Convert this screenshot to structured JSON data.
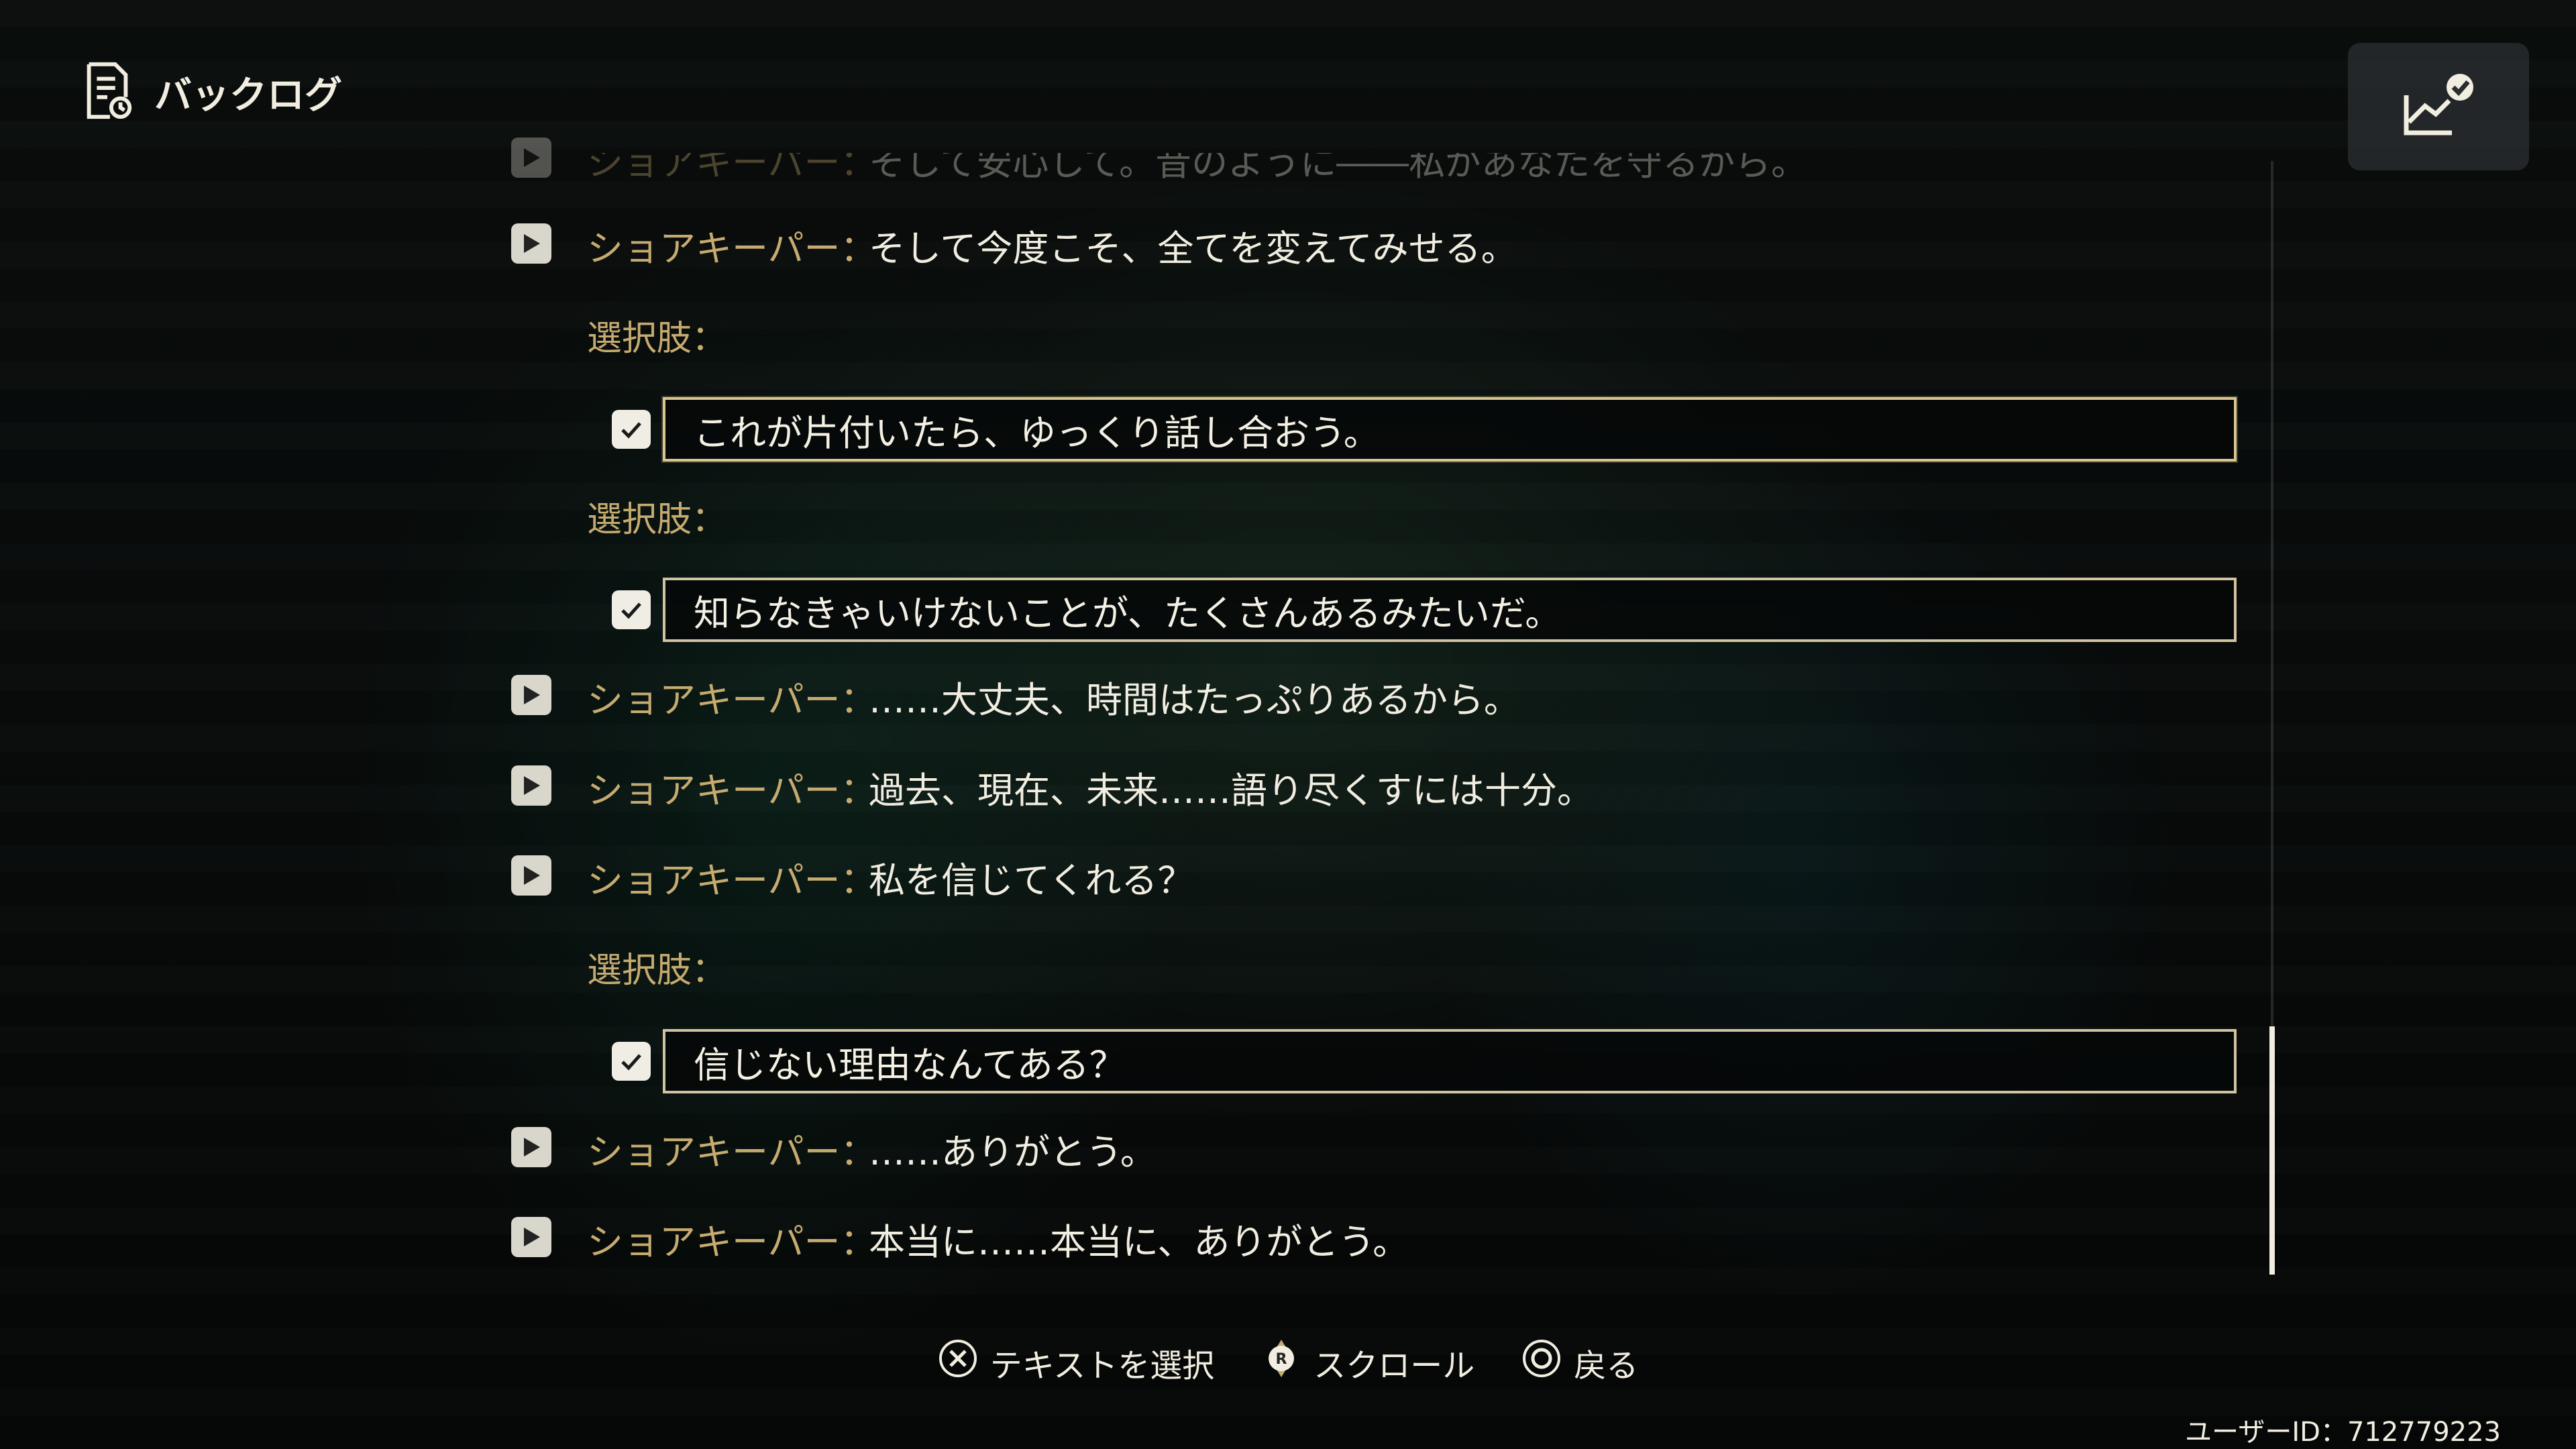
{
  "header": {
    "title": "バックログ",
    "icon": "backlog-document-icon"
  },
  "top_right": {
    "icon": "progress-chart-check-icon"
  },
  "log": {
    "partial_line": {
      "speaker": "ショアキーパー：",
      "text": "そして安心して。昔のように――私があなたを守るから。"
    },
    "entries": [
      {
        "type": "line",
        "speaker": "ショアキーパー：",
        "text": "そして今度こそ、全てを変えてみせる。"
      },
      {
        "type": "choice",
        "label": "選択肢：",
        "text": "これが片付いたら、ゆっくり話し合おう。"
      },
      {
        "type": "choice",
        "label": "選択肢：",
        "text": "知らなきゃいけないことが、たくさんあるみたいだ。"
      },
      {
        "type": "line",
        "speaker": "ショアキーパー：",
        "text": "……大丈夫、時間はたっぷりあるから。"
      },
      {
        "type": "line",
        "speaker": "ショアキーパー：",
        "text": "過去、現在、未来……語り尽くすには十分。"
      },
      {
        "type": "line",
        "speaker": "ショアキーパー：",
        "text": "私を信じてくれる？"
      },
      {
        "type": "choice",
        "label": "選択肢：",
        "text": "信じない理由なんてある？"
      },
      {
        "type": "line",
        "speaker": "ショアキーパー：",
        "text": "……ありがとう。"
      },
      {
        "type": "line",
        "speaker": "ショアキーパー：",
        "text": "本当に……本当に、ありがとう。"
      }
    ]
  },
  "footer": {
    "hints": [
      {
        "icon": "cross-button-icon",
        "label": "テキストを選択"
      },
      {
        "icon": "right-stick-icon",
        "label": "スクロール"
      },
      {
        "icon": "circle-button-icon",
        "label": "戻る"
      }
    ]
  },
  "user_id": "ユーザーID：712779223",
  "colors": {
    "speaker": "#c6ab70",
    "text": "#f1ede0",
    "choice_border": "#cfc3a0"
  }
}
